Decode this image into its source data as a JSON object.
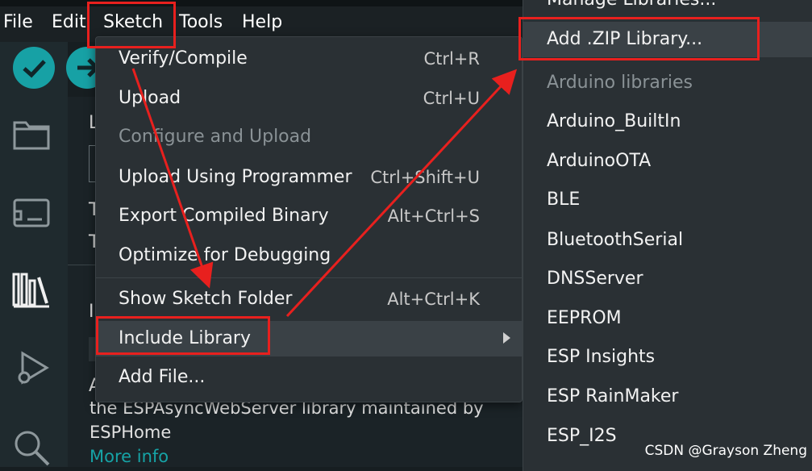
{
  "menubar": {
    "items": [
      "File",
      "Edit",
      "Sketch",
      "Tools",
      "Help"
    ]
  },
  "sketch_menu": {
    "items": [
      {
        "label": "Verify/Compile",
        "shortcut": "Ctrl+R"
      },
      {
        "label": "Upload",
        "shortcut": "Ctrl+U"
      },
      {
        "label": "Configure and Upload",
        "shortcut": ""
      },
      {
        "label": "Upload Using Programmer",
        "shortcut": "Ctrl+Shift+U"
      },
      {
        "label": "Export Compiled Binary",
        "shortcut": "Alt+Ctrl+S"
      },
      {
        "label": "Optimize for Debugging",
        "shortcut": ""
      },
      {
        "label": "Show Sketch Folder",
        "shortcut": "Alt+Ctrl+K"
      },
      {
        "label": "Include Library",
        "shortcut": ""
      },
      {
        "label": "Add File...",
        "shortcut": ""
      }
    ]
  },
  "library_menu": {
    "manage": "Manage Libraries...",
    "add_zip": "Add .ZIP Library...",
    "section_header": "Arduino libraries",
    "libraries": [
      "Arduino_BuiltIn",
      "ArduinoOTA",
      "BLE",
      "BluetoothSerial",
      "DNSServer",
      "EEPROM",
      "ESP Insights",
      "ESP RainMaker",
      "ESP_I2S"
    ]
  },
  "background_panel": {
    "letters": [
      "L",
      "T",
      "T",
      "I",
      "A"
    ],
    "description_line1": "the ESPAsyncWebServer library maintained by",
    "description_line2": "ESPHome",
    "more_info": "More info"
  },
  "watermark": "CSDN @Grayson Zheng",
  "colors": {
    "accent": "#17a1a5",
    "annotation_red": "#e8201e",
    "menu_bg": "#2a3034",
    "highlight_bg": "#3a4146"
  },
  "icons": [
    "verify-check-icon",
    "upload-arrow-icon",
    "folder-icon",
    "board-icon",
    "library-icon",
    "debug-icon",
    "search-icon",
    "submenu-arrow-icon"
  ]
}
